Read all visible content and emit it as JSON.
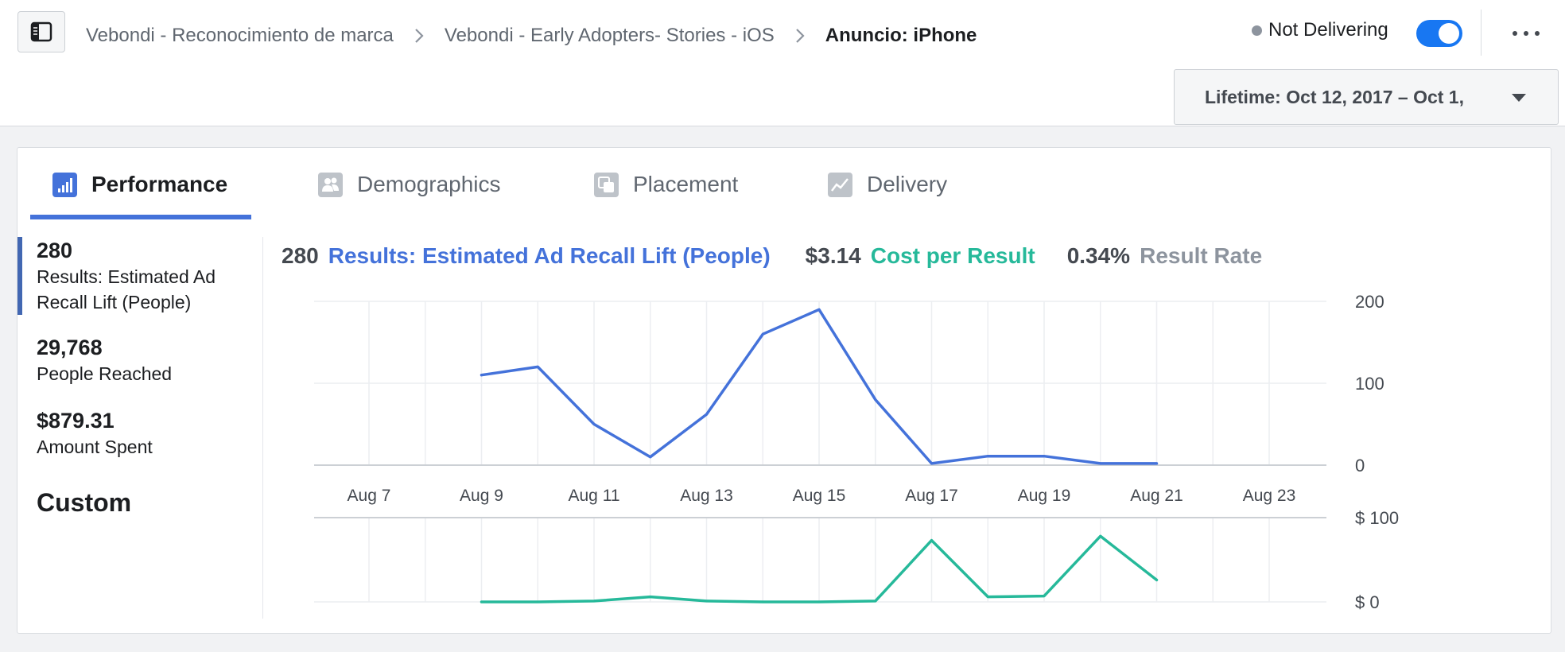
{
  "breadcrumb": {
    "items": [
      "Vebondi - Reconocimiento de marca",
      "Vebondi - Early Adopters- Stories - iOS",
      "Anuncio: iPhone"
    ]
  },
  "status": {
    "label": "Not Delivering",
    "toggle_on": true
  },
  "date_range": {
    "label": "Lifetime: Oct 12, 2017 – Oct 1,"
  },
  "tabs": [
    {
      "label": "Performance",
      "icon": "bar-chart-icon",
      "active": true
    },
    {
      "label": "Demographics",
      "icon": "people-icon",
      "active": false
    },
    {
      "label": "Placement",
      "icon": "placement-icon",
      "active": false
    },
    {
      "label": "Delivery",
      "icon": "line-chart-icon",
      "active": false
    }
  ],
  "metrics": [
    {
      "value": "280",
      "label": "Results: Estimated Ad Recall Lift (People)"
    },
    {
      "value": "29,768",
      "label": "People Reached"
    },
    {
      "value": "$879.31",
      "label": "Amount Spent"
    }
  ],
  "custom_label": "Custom",
  "summary": {
    "results_value": "280",
    "results_label": "Results: Estimated Ad Recall Lift (People)",
    "cost_value": "$3.14",
    "cost_label": "Cost per Result",
    "rate_value": "0.34%",
    "rate_label": "Result Rate"
  },
  "colors": {
    "results": "#4472da",
    "cost": "#26b99a",
    "rate": "#8d949e",
    "toggle": "#1877f2"
  },
  "chart_data": [
    {
      "type": "line",
      "title": "",
      "xlabel": "",
      "ylabel": "",
      "x_ticks": [
        "Aug 7",
        "Aug 9",
        "Aug 11",
        "Aug 13",
        "Aug 15",
        "Aug 17",
        "Aug 19",
        "Aug 21",
        "Aug 23"
      ],
      "y_ticks": [
        "0",
        "100",
        "200"
      ],
      "ylim": [
        0,
        200
      ],
      "grid": true,
      "series": [
        {
          "color": "#4472da",
          "x": [
            "Aug 9",
            "Aug 10",
            "Aug 11",
            "Aug 12",
            "Aug 13",
            "Aug 14",
            "Aug 15",
            "Aug 16",
            "Aug 17",
            "Aug 18",
            "Aug 19",
            "Aug 20",
            "Aug 21"
          ],
          "values": [
            110,
            120,
            50,
            10,
            62,
            160,
            190,
            80,
            2,
            11,
            11,
            2,
            2
          ]
        }
      ]
    },
    {
      "type": "line",
      "title": "",
      "xlabel": "",
      "ylabel": "",
      "y_ticks": [
        "$ 0",
        "$ 100"
      ],
      "ylim": [
        0,
        100
      ],
      "grid": true,
      "series": [
        {
          "color": "#26b99a",
          "x": [
            "Aug 9",
            "Aug 10",
            "Aug 11",
            "Aug 12",
            "Aug 13",
            "Aug 14",
            "Aug 15",
            "Aug 16",
            "Aug 17",
            "Aug 18",
            "Aug 19",
            "Aug 20",
            "Aug 21"
          ],
          "values": [
            0,
            0,
            1,
            6,
            1,
            0,
            0,
            1,
            73,
            6,
            7,
            78,
            26
          ]
        }
      ]
    }
  ]
}
